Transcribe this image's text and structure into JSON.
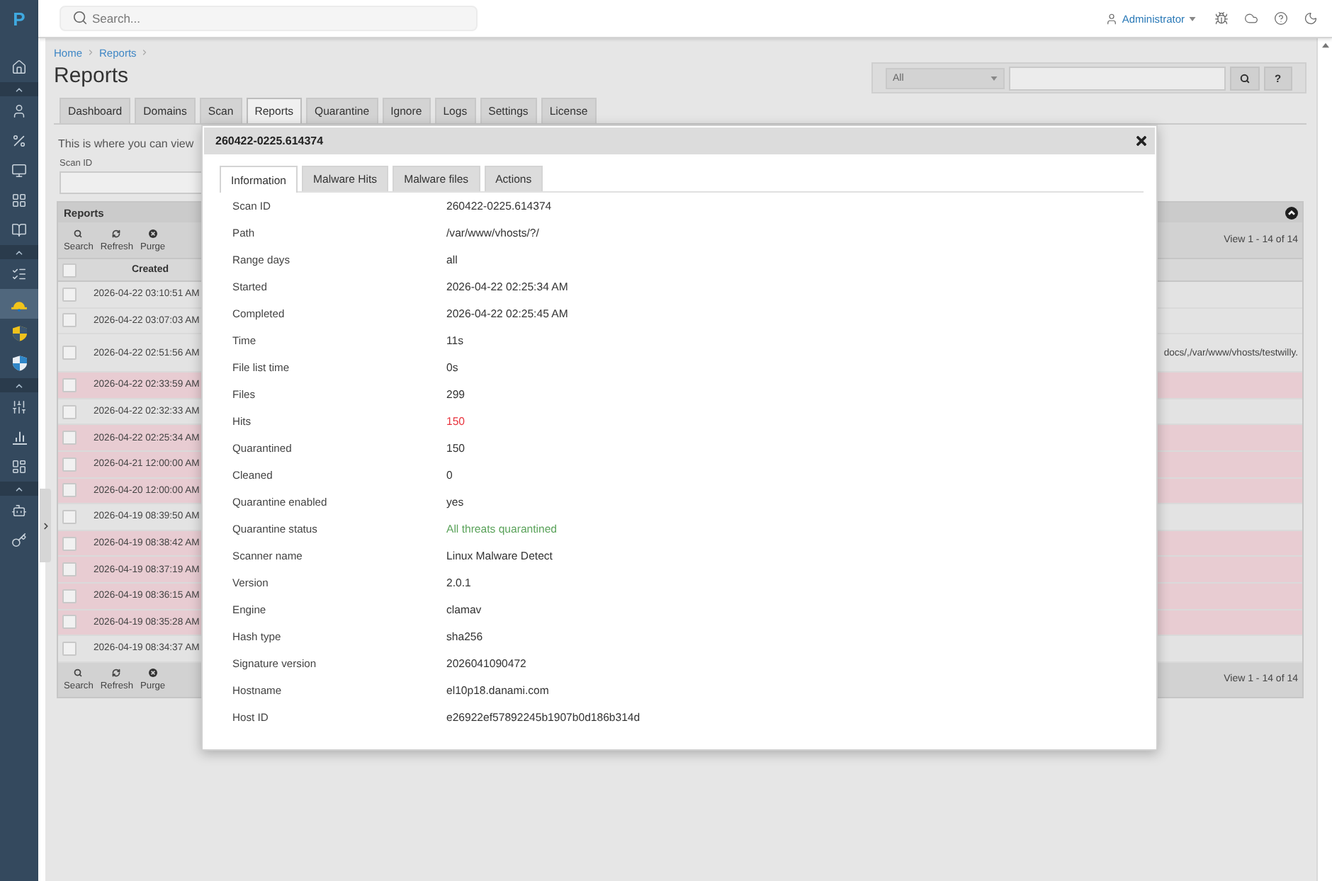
{
  "sidebar": {
    "logo": "P",
    "sections": [
      {
        "items": [
          {
            "selected": false
          }
        ]
      },
      {
        "expanded": true,
        "items": [
          {
            "selected": false
          },
          {
            "selected": false
          },
          {
            "selected": false
          },
          {
            "selected": false
          },
          {
            "selected": false
          }
        ]
      },
      {
        "expanded": true,
        "items": [
          {
            "selected": false
          },
          {
            "selected": true
          },
          {
            "selected": false
          },
          {
            "selected": false
          }
        ]
      },
      {
        "expanded": true,
        "items": [
          {
            "selected": false
          },
          {
            "selected": false
          },
          {
            "selected": false
          }
        ]
      },
      {
        "expanded": true,
        "items": [
          {
            "selected": false
          },
          {
            "selected": false
          }
        ]
      }
    ]
  },
  "header": {
    "search": {
      "placeholder": "Search..."
    },
    "user": "Administrator"
  },
  "breadcrumb": [
    "Home",
    "Reports"
  ],
  "page_title": "Reports",
  "filter": {
    "scope": "All",
    "help": "?"
  },
  "tabs": [
    {
      "label": "Dashboard",
      "selected": false
    },
    {
      "label": "Domains",
      "selected": false
    },
    {
      "label": "Scan",
      "selected": false
    },
    {
      "label": "Reports",
      "selected": true
    },
    {
      "label": "Quarantine",
      "selected": false
    },
    {
      "label": "Ignore",
      "selected": false
    },
    {
      "label": "Logs",
      "selected": false
    },
    {
      "label": "Settings",
      "selected": false
    },
    {
      "label": "License",
      "selected": false
    }
  ],
  "intro": "This is where you can view",
  "scan_id": {
    "label": "Scan ID"
  },
  "grid": {
    "title": "Reports",
    "expanded": true,
    "toolbar": [
      {
        "kind": "search",
        "label": "Search"
      },
      {
        "kind": "refresh",
        "label": "Refresh"
      },
      {
        "kind": "purge",
        "label": "Purge"
      }
    ],
    "pager": "View 1 - 14 of 14",
    "select_all": {
      "checked": false
    },
    "columns": [
      "Created"
    ],
    "rows": [
      {
        "created": "2026-04-22 03:10:51 AM",
        "checked": false,
        "highlighted": false
      },
      {
        "created": "2026-04-22 03:07:03 AM",
        "checked": false,
        "highlighted": false
      },
      {
        "created": "2026-04-22 02:51:56 AM",
        "checked": false,
        "highlighted": false,
        "column_3": "docs/,/var/www/vhosts/testwilly."
      },
      {
        "created": "2026-04-22 02:33:59 AM",
        "checked": false,
        "highlighted": true
      },
      {
        "created": "2026-04-22 02:32:33 AM",
        "checked": false,
        "highlighted": false
      },
      {
        "created": "2026-04-22 02:25:34 AM",
        "checked": false,
        "highlighted": true
      },
      {
        "created": "2026-04-21 12:00:00 AM",
        "checked": false,
        "highlighted": true
      },
      {
        "created": "2026-04-20 12:00:00 AM",
        "checked": false,
        "highlighted": true
      },
      {
        "created": "2026-04-19 08:39:50 AM",
        "checked": false,
        "highlighted": false
      },
      {
        "created": "2026-04-19 08:38:42 AM",
        "checked": false,
        "highlighted": true
      },
      {
        "created": "2026-04-19 08:37:19 AM",
        "checked": false,
        "highlighted": true
      },
      {
        "created": "2026-04-19 08:36:15 AM",
        "checked": false,
        "highlighted": true
      },
      {
        "created": "2026-04-19 08:35:28 AM",
        "checked": false,
        "highlighted": true
      },
      {
        "created": "2026-04-19 08:34:37 AM",
        "checked": false,
        "highlighted": false
      }
    ],
    "footer_toolbar": [
      {
        "kind": "search",
        "label": "Search"
      },
      {
        "kind": "refresh",
        "label": "Refresh"
      },
      {
        "kind": "purge",
        "label": "Purge"
      }
    ],
    "footer_pager": "View 1 - 14 of 14"
  },
  "modal": {
    "title": "260422-0225.614374",
    "tabs": [
      {
        "label": "Information",
        "selected": true
      },
      {
        "label": "Malware Hits",
        "selected": false
      },
      {
        "label": "Malware files",
        "selected": false
      },
      {
        "label": "Actions",
        "selected": false
      }
    ],
    "fields": [
      {
        "label": "Scan ID",
        "value": "260422-0225.614374"
      },
      {
        "label": "Path",
        "value": "/var/www/vhosts/?/"
      },
      {
        "label": "Range days",
        "value": "all"
      },
      {
        "label": "Started",
        "value": "2026-04-22 02:25:34 AM"
      },
      {
        "label": "Completed",
        "value": "2026-04-22 02:25:45 AM"
      },
      {
        "label": "Time",
        "value": "11s"
      },
      {
        "label": "File list time",
        "value": "0s"
      },
      {
        "label": "Files",
        "value": "299"
      },
      {
        "label": "Hits",
        "value": "150",
        "color": "#e8333d"
      },
      {
        "label": "Quarantined",
        "value": "150"
      },
      {
        "label": "Cleaned",
        "value": "0"
      },
      {
        "label": "Quarantine enabled",
        "value": "yes"
      },
      {
        "label": "Quarantine status",
        "value": "All threats quarantined",
        "color": "#5ba35b"
      },
      {
        "label": "Scanner name",
        "value": "Linux Malware Detect"
      },
      {
        "label": "Version",
        "value": "2.0.1"
      },
      {
        "label": "Engine",
        "value": "clamav"
      },
      {
        "label": "Hash type",
        "value": "sha256"
      },
      {
        "label": "Signature version",
        "value": "2026041090472"
      },
      {
        "label": "Hostname",
        "value": "el10p18.danami.com"
      },
      {
        "label": "Host ID",
        "value": "e26922ef57892245b1907b0d186b314d"
      }
    ]
  }
}
